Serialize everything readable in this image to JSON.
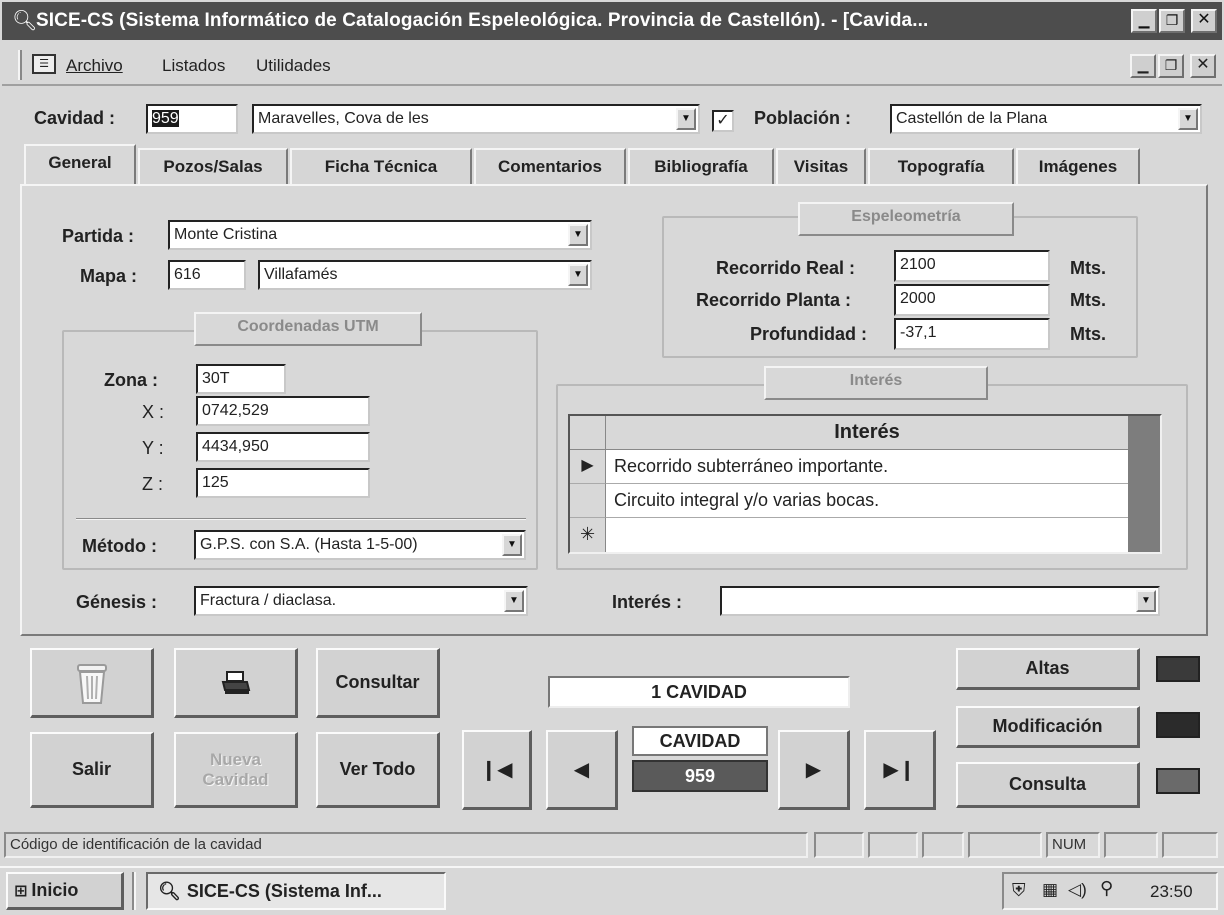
{
  "titlebar": {
    "title": "SICE-CS (Sistema Informático de Catalogación Espeleológica.  Provincia de Castellón). - [Cavida..."
  },
  "menubar": {
    "items": [
      "Archivo",
      "Listados",
      "Utilidades"
    ]
  },
  "header": {
    "cavidad_label": "Cavidad :",
    "cavidad_code": "959",
    "cavidad_name": "Maravelles, Cova de les",
    "checkbox_mark": "✓",
    "poblacion_label": "Población :",
    "poblacion_value": "Castellón de la Plana"
  },
  "tabs": [
    "General",
    "Pozos/Salas",
    "Ficha Técnica",
    "Comentarios",
    "Bibliografía",
    "Visitas",
    "Topografía",
    "Imágenes"
  ],
  "general": {
    "partida_label": "Partida :",
    "partida_value": "Monte Cristina",
    "mapa_label": "Mapa :",
    "mapa_code": "616",
    "mapa_name": "Villafamés",
    "utm_title": "Coordenadas UTM",
    "zona_label": "Zona :",
    "zona_value": "30T",
    "x_label": "X :",
    "x_value": "0742,529",
    "y_label": "Y :",
    "y_value": "4434,950",
    "z_label": "Z :",
    "z_value": "125",
    "metodo_label": "Método :",
    "metodo_value": "G.P.S. con S.A. (Hasta 1-5-00)",
    "genesis_label": "Génesis :",
    "genesis_value": "Fractura / diaclasa."
  },
  "espeleometria": {
    "title": "Espeleometría",
    "recorrido_real_label": "Recorrido Real :",
    "recorrido_real_value": "2100",
    "recorrido_planta_label": "Recorrido Planta :",
    "recorrido_planta_value": "2000",
    "profundidad_label": "Profundidad :",
    "profundidad_value": "-37,1",
    "unit": "Mts."
  },
  "interes": {
    "title": "Interés",
    "column_header": "Interés",
    "rows": [
      "Recorrido subterráneo importante.",
      "Circuito integral y/o varias bocas.",
      ""
    ],
    "row_markers": [
      "▶",
      "",
      "✳"
    ],
    "filter_label": "Interés :",
    "filter_value": ""
  },
  "buttons": {
    "consultar": "Consultar",
    "salir": "Salir",
    "nueva_cavidad": "Nueva Cavidad",
    "ver_todo": "Ver Todo",
    "altas": "Altas",
    "modificacion": "Modificación",
    "consulta": "Consulta"
  },
  "navigator": {
    "count_text": "1 CAVIDAD",
    "record_label": "CAVIDAD",
    "record_value": "959"
  },
  "statusbar": {
    "message": "Código de identificación de la cavidad",
    "num": "NUM"
  },
  "taskbar": {
    "start_label": "Inicio",
    "task_label": "SICE-CS (Sistema Inf...",
    "clock": "23:50"
  },
  "colors": {
    "titlebar": "#4d4d4d",
    "window_bg": "#d8d8d8",
    "record_bg": "#5a5a5a"
  }
}
